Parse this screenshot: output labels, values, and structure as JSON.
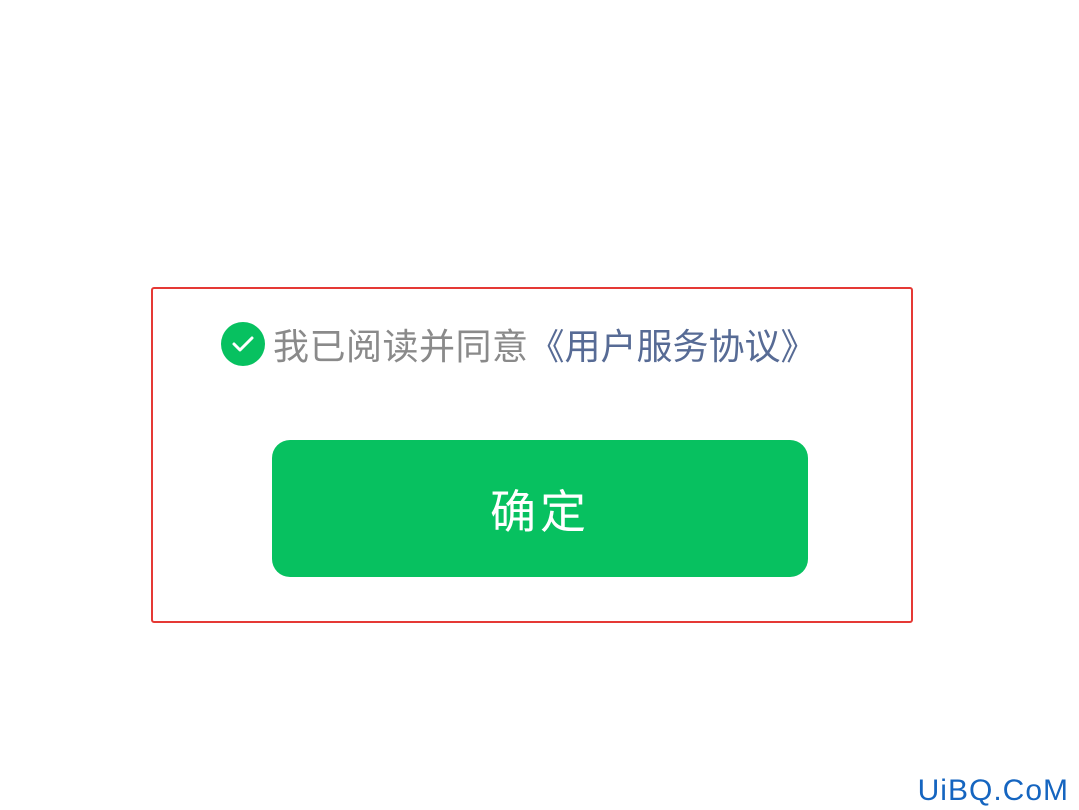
{
  "agreement": {
    "checked": true,
    "text": "我已阅读并同意",
    "link": "《用户服务协议》"
  },
  "confirm_button": {
    "label": "确定"
  },
  "watermark": {
    "text": "UiBQ.CoM"
  },
  "colors": {
    "accent": "#07c160",
    "link": "#576b95",
    "highlight_border": "#e53935",
    "watermark": "#1565c0"
  },
  "icons": {
    "checkbox": "check-circle-icon"
  }
}
